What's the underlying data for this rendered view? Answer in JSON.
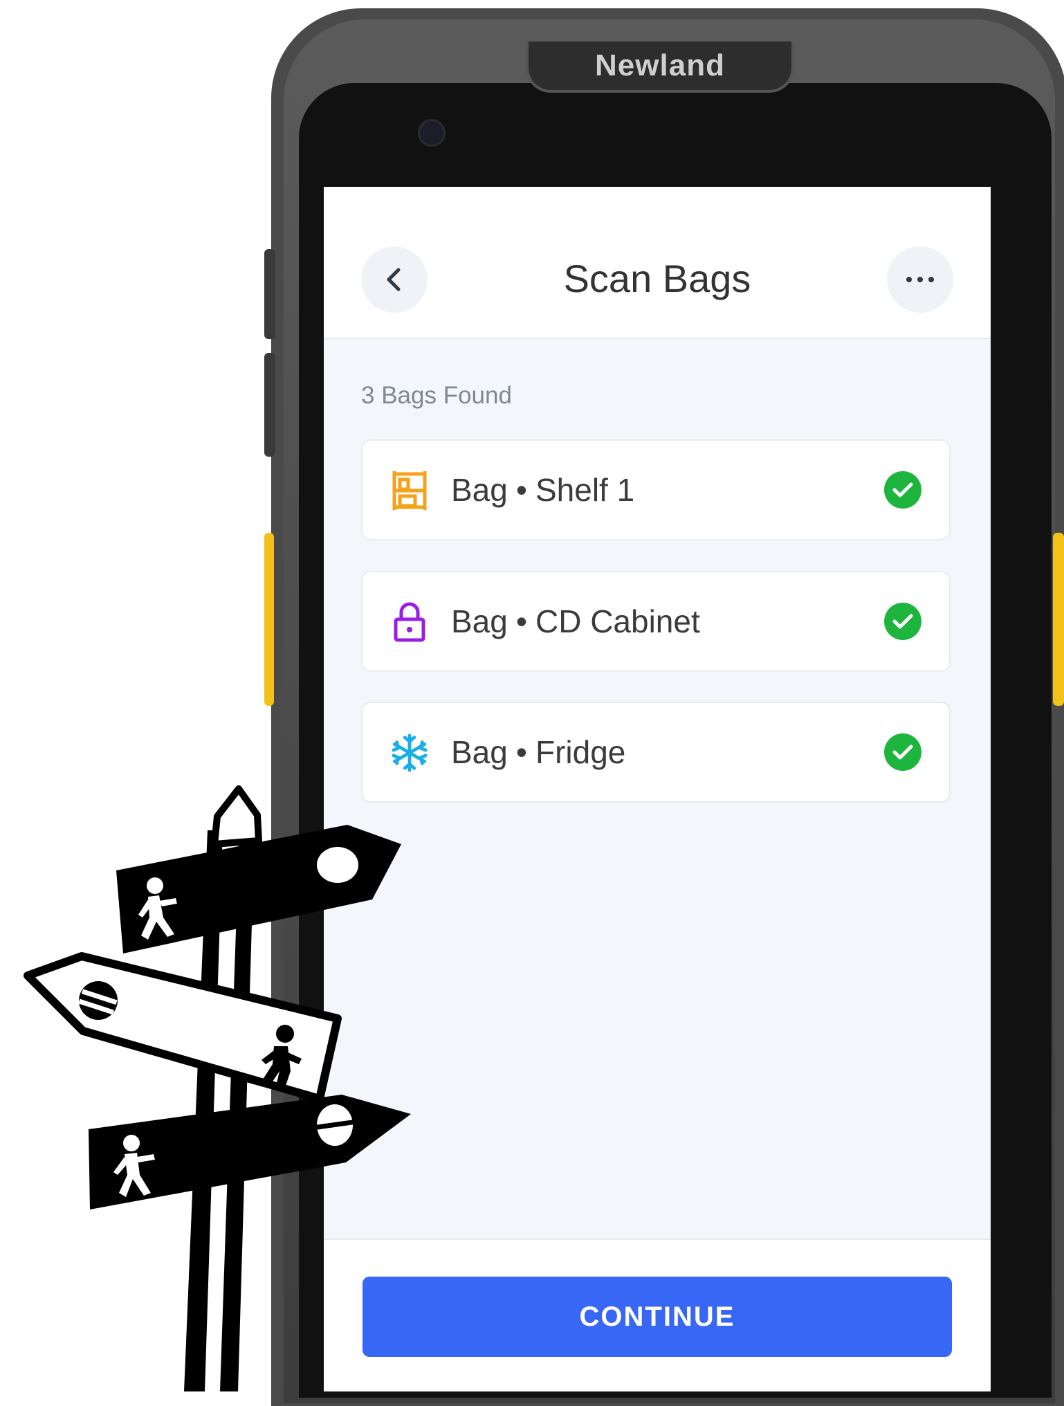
{
  "device": {
    "brand": "Newland"
  },
  "header": {
    "title": "Scan Bags",
    "back_icon": "chevron-left-icon",
    "more_icon": "ellipsis-icon"
  },
  "list": {
    "found_label": "3 Bags Found",
    "items": [
      {
        "type": "Bag",
        "location": "Shelf 1",
        "icon": "shelf-icon",
        "icon_color": "#f5a11b",
        "status": "scanned"
      },
      {
        "type": "Bag",
        "location": "CD Cabinet",
        "icon": "lock-icon",
        "icon_color": "#9b1de3",
        "status": "scanned"
      },
      {
        "type": "Bag",
        "location": "Fridge",
        "icon": "snowflake-icon",
        "icon_color": "#1aaee8",
        "status": "scanned"
      }
    ],
    "separator": "•",
    "check_color": "#1db53e"
  },
  "footer": {
    "continue_label": "CONTINUE",
    "button_color": "#3767f4"
  }
}
